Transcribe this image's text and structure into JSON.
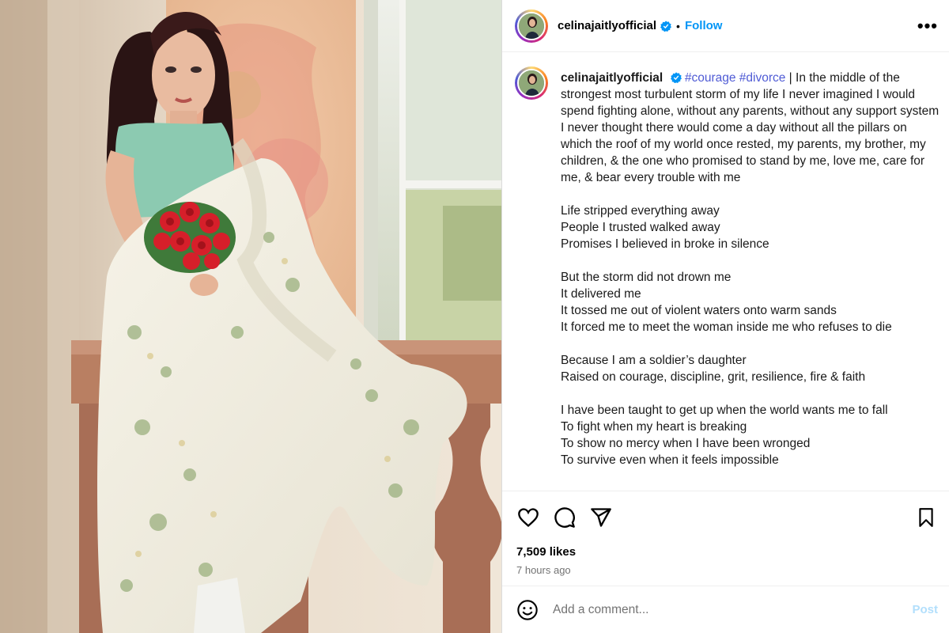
{
  "post": {
    "username": "celinajaitlyofficial",
    "follow_label": "Follow",
    "separator": "•",
    "more_label": "•••"
  },
  "caption": {
    "username": "celinajaitlyofficial",
    "hashtags": "#courage #divorce",
    "intro": " | In the middle of the strongest most turbulent storm of my life I never imagined I would spend fighting alone, without any parents, without any support system I never thought there would come a day without all the pillars on which the roof of my world once rested, my parents, my brother, my children, & the one who promised to stand by me, love me, care for me, & bear every trouble with me",
    "stanzas": [
      [
        "Life stripped everything away",
        "People I trusted walked away",
        "Promises I believed in broke in silence"
      ],
      [
        "But the storm did not drown me",
        "It delivered me",
        "It tossed me out of violent waters onto warm sands",
        "It forced me to meet the woman inside me who refuses to die"
      ],
      [
        "Because I am a soldier’s daughter",
        "Raised on courage, discipline, grit, resilience, fire & faith"
      ],
      [
        "I have been taught to get up when the world wants me to fall",
        "To fight when my heart is breaking",
        "To show no mercy when I have been wronged",
        "To survive even when it feels impossible"
      ]
    ]
  },
  "engagement": {
    "likes": "7,509 likes",
    "time": "7 hours ago"
  },
  "comment_box": {
    "placeholder": "Add a comment...",
    "post_label": "Post"
  },
  "icons": {
    "like": "heart-icon",
    "comment": "comment-icon",
    "share": "share-icon",
    "save": "bookmark-icon",
    "emoji": "emoji-icon",
    "verified": "verified-badge-icon"
  },
  "colors": {
    "link": "#0095f6",
    "hashtag": "#4f5bd5",
    "muted": "#737373",
    "post_disabled": "#b2dffc"
  }
}
